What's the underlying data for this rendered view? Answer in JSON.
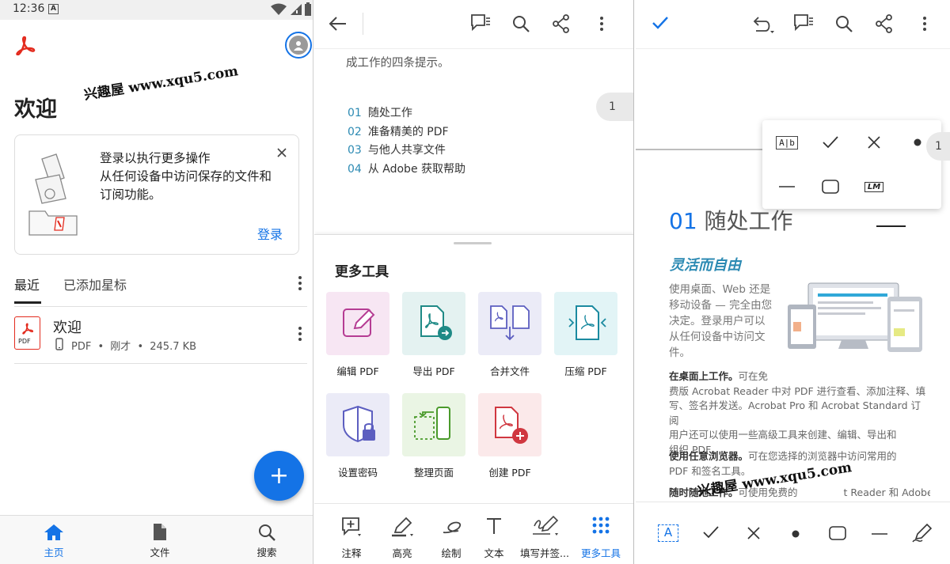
{
  "status": {
    "time": "12:36",
    "badge": "A"
  },
  "home": {
    "welcome_title": "欢迎",
    "watermark": "兴趣屋 www.xqu5.com",
    "card": {
      "line1": "登录以执行更多操作",
      "line2": "从任何设备中访问保存的文件和",
      "line3": "订阅功能。",
      "login_label": "登录"
    },
    "tabs": {
      "recent": "最近",
      "starred": "已添加星标"
    },
    "file": {
      "name": "欢迎",
      "type": "PDF",
      "time": "刚才",
      "size": "245.7 KB",
      "thumb_label": "PDF",
      "sep": "•"
    },
    "nav": {
      "home": "主页",
      "files": "文件",
      "search": "搜索"
    },
    "fab_label": "+"
  },
  "viewer": {
    "doc_line": "成工作的四条提示。",
    "toc": [
      {
        "num": "01",
        "text": "随处工作"
      },
      {
        "num": "02",
        "text": "准备精美的 PDF"
      },
      {
        "num": "03",
        "text": "与他人共享文件"
      },
      {
        "num": "04",
        "text": "从 Adobe 获取帮助"
      }
    ],
    "page_badge": "1",
    "sheet_title": "更多工具",
    "tools": [
      {
        "label": "编辑 PDF",
        "color": "#f7e6f3"
      },
      {
        "label": "导出 PDF",
        "color": "#e4f2f1"
      },
      {
        "label": "合并文件",
        "color": "#ebebf7"
      },
      {
        "label": "压缩 PDF",
        "color": "#e2f4f6"
      },
      {
        "label": "设置密码",
        "color": "#ebebf7"
      },
      {
        "label": "整理页面",
        "color": "#eaf5e4"
      },
      {
        "label": "创建 PDF",
        "color": "#fbe9ea"
      }
    ],
    "bottom_nav": [
      "注释",
      "高亮",
      "绘制",
      "文本",
      "填写并签...",
      "更多工具"
    ]
  },
  "editor": {
    "section_num": "01",
    "section_title": "随处工作",
    "subtitle": "灵活而自由",
    "intro": [
      "使用桌面、Web 还是",
      "移动设备 — 完全由您",
      "决定。登录用户可以",
      "从任何设备中访问文",
      "件。"
    ],
    "para1_bold": "在桌面上工作。",
    "para1_lines": [
      "可在免",
      "费版 Acrobat Reader 中对 PDF 进行查看、添加注释、填",
      "写、签名并发送。Acrobat Pro 和 Acrobat Standard 订阅",
      "用户还可以使用一些高级工具来创建、编辑、导出和",
      "组织 PDF。"
    ],
    "para2_bold": "使用任意浏览器。",
    "para2_lines": [
      "可在您选择的浏览器中访问常用的",
      "PDF 和签名工具。"
    ],
    "para3_bold": "随时随地工作。",
    "para3_rest": "可使用免费的",
    "para3_tail": "t Reader 和 Adobe",
    "page_badge": "1",
    "popup": {
      "text_field_icon": "A|b",
      "lm_icon": "LM"
    },
    "watermark": "兴趣屋 www.xqu5.com",
    "text_tool_label": "A"
  },
  "colors": {
    "blue": "#1473e6",
    "red": "#e32b1e",
    "teal": "#2c8ab3"
  }
}
